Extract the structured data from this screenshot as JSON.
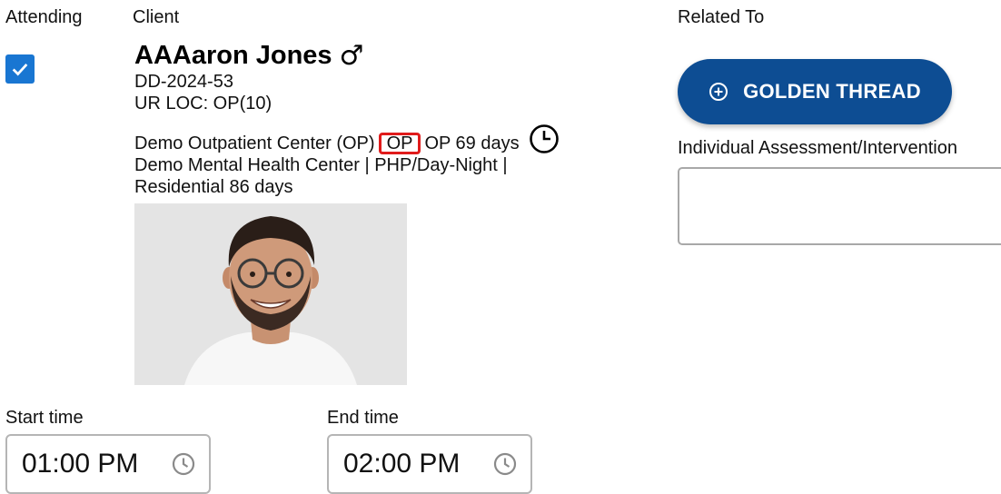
{
  "headers": {
    "attending": "Attending",
    "client": "Client",
    "related_to": "Related To"
  },
  "attending_checked": true,
  "client": {
    "name": "AAAaron Jones",
    "gender_symbol": "♂",
    "id": "DD-2024-53",
    "ur_loc": "UR LOC: OP(10)",
    "program_prefix": "Demo Outpatient Center (OP)",
    "program_badge": "OP",
    "program_suffix": "OP 69 days",
    "program_line2": "Demo Mental Health Center | PHP/Day-Night |",
    "program_line3": "Residential 86 days"
  },
  "golden_thread": {
    "label": "GOLDEN THREAD"
  },
  "assessment": {
    "label": "Individual Assessment/Intervention",
    "value": ""
  },
  "start_time": {
    "label": "Start time",
    "value": "01:00 PM"
  },
  "end_time": {
    "label": "End time",
    "value": "02:00 PM"
  },
  "colors": {
    "primary": "#0d4d93",
    "checkbox": "#1976d2",
    "badge_border": "#e01b1b"
  },
  "icons": [
    "check-icon",
    "male-icon",
    "clock-icon",
    "plus-circle-icon",
    "clock-outline-icon"
  ]
}
